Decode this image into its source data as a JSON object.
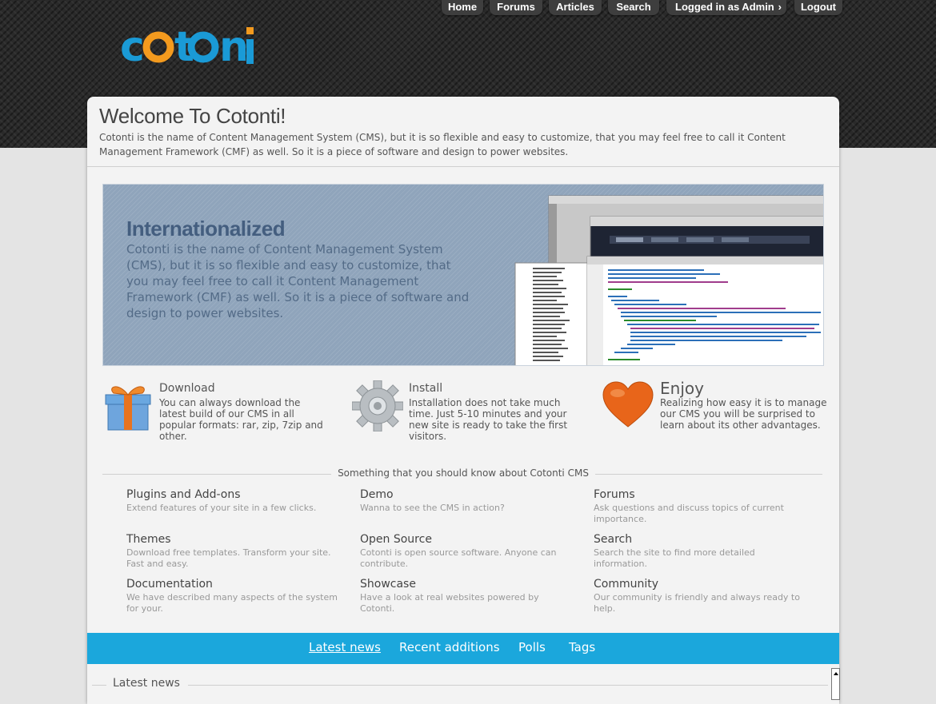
{
  "nav": {
    "items": [
      {
        "label": "Home"
      },
      {
        "label": "Forums"
      },
      {
        "label": "Articles"
      },
      {
        "label": "Search"
      },
      {
        "label": "Logged in as Admin"
      },
      {
        "label": "Logout"
      }
    ]
  },
  "logo": {
    "text": "cotonti"
  },
  "welcome": {
    "title": "Welcome To Cotonti!",
    "text": "Cotonti is the name of Content Management System (CMS), but it is so flexible and easy to customize, that you may feel free to call it Content Management Framework (CMF) as well. So it is a piece of software and design to power websites."
  },
  "banner": {
    "title": "Internationalized",
    "text": "Cotonti is the name of Content Management System (CMS), but it is so flexible and easy to customize, that you may feel free to call it Content Management Framework (CMF) as well. So it is a piece of software and design to power websites."
  },
  "features": [
    {
      "title": "Download",
      "text": "You can always download the latest build of our CMS in all popular formats: rar, zip, 7zip and other.",
      "icon": "gift-icon"
    },
    {
      "title": "Install",
      "text": "Installation does not take much time. Just 5-10 minutes and your new site is ready to take the first visitors.",
      "icon": "gear-icon"
    },
    {
      "title": "Enjoy",
      "text": "Realizing how easy it is to manage our CMS you will be surprised to learn about its other advantages.",
      "icon": "heart-icon"
    }
  ],
  "know": {
    "heading": "Something that you should know about Cotonti CMS",
    "items": [
      {
        "title": "Plugins and Add-ons",
        "desc": "Extend features of your site in a few clicks."
      },
      {
        "title": "Demo",
        "desc": "Wanna to see the CMS in action?"
      },
      {
        "title": "Forums",
        "desc": "Ask questions and discuss topics of current importance."
      },
      {
        "title": "Themes",
        "desc": "Download free templates. Transform your site. Fast and easy."
      },
      {
        "title": "Open Source",
        "desc": "Cotonti is open source software. Anyone can contribute."
      },
      {
        "title": "Search",
        "desc": "Search the site to find more detailed information."
      },
      {
        "title": "Documentation",
        "desc": "We have described many aspects of the system for your."
      },
      {
        "title": "Showcase",
        "desc": "Have a look at real websites powered by Cotonti."
      },
      {
        "title": "Community",
        "desc": "Our community is friendly and always ready to help."
      }
    ]
  },
  "tabs": [
    {
      "label": "Latest news"
    },
    {
      "label": "Recent additions"
    },
    {
      "label": "Polls"
    },
    {
      "label": "Tags"
    }
  ],
  "latest": {
    "title": "Latest news"
  },
  "colors": {
    "accent": "#1ba7dc",
    "header": "#2a2a2a",
    "banner": "#8fa4bb"
  }
}
